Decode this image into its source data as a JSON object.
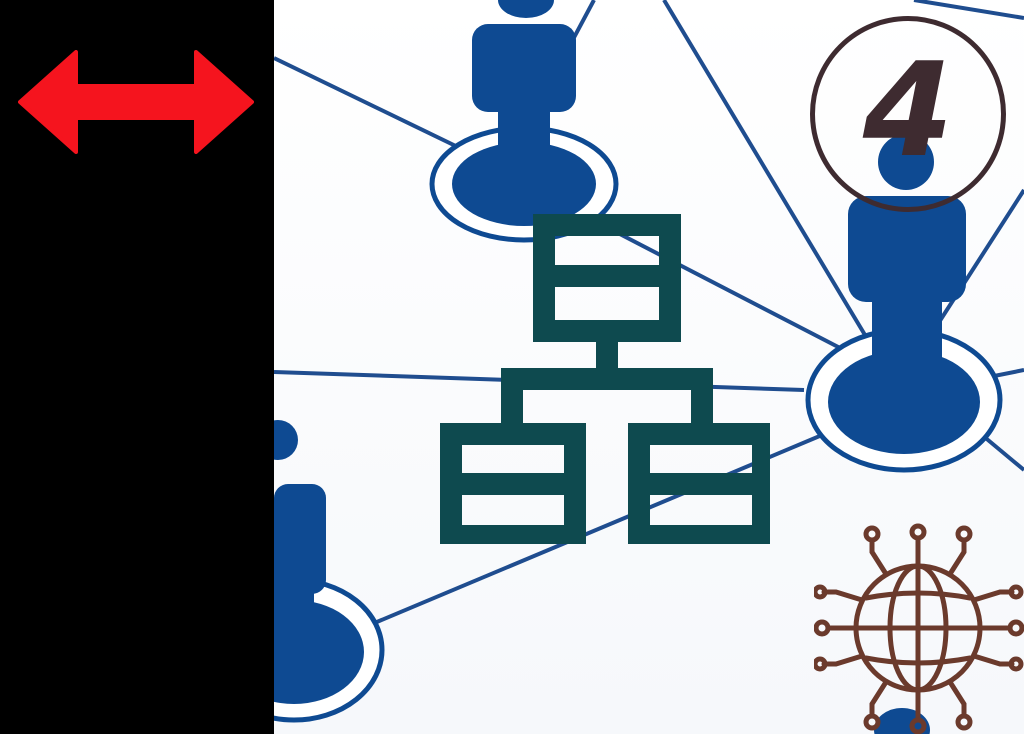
{
  "step_badge": {
    "number": "4"
  },
  "icons": {
    "swap": "double-headed-arrow-icon",
    "network": "people-network-illustration",
    "hierarchy": "org-chart-icon",
    "globe": "global-network-icon"
  },
  "colors": {
    "panel": "#000000",
    "arrow": "#f5141e",
    "people": "#0e4a92",
    "links": "#1f4d8f",
    "hierarchy": "#0e4a4f",
    "globe": "#6b3a2c",
    "badge": "#3e2b30"
  }
}
